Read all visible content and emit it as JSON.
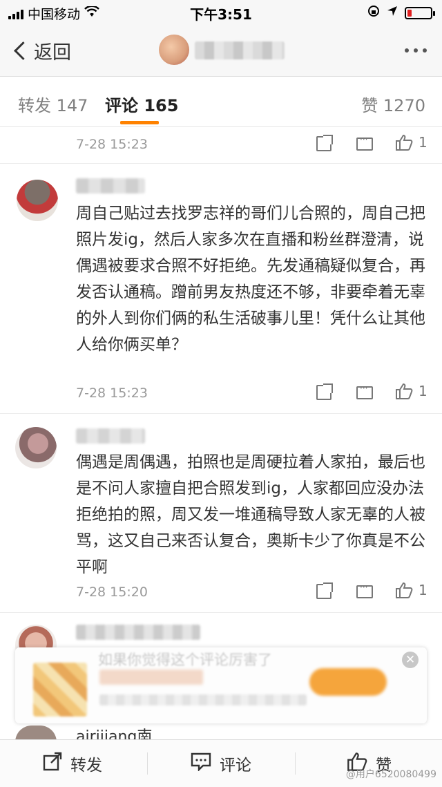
{
  "status_bar": {
    "carrier": "中国移动",
    "time": "下午3:51"
  },
  "nav": {
    "back_label": "返回"
  },
  "tabs": [
    {
      "label": "转发 147"
    },
    {
      "label": "评论 165"
    },
    {
      "label": "赞 1270"
    }
  ],
  "comments": [
    {
      "time": "7-28 15:23",
      "likes": "1"
    },
    {
      "text": "周自己贴过去找罗志祥的哥们儿合照的，周自己把照片发ig，然后人家多次在直播和粉丝群澄清，说偶遇被要求合照不好拒绝。先发通稿疑似复合，再发否认通稿。蹭前男友热度还不够，非要牵着无辜的外人到你们俩的私生活破事儿里！凭什么让其他人给你俩买单？",
      "time": "7-28 15:23",
      "likes": "1"
    },
    {
      "text": "偶遇是周偶遇，拍照也是周硬拉着人家拍，最后也是不问人家擅自把合照发到ig，人家都回应没办法拒绝拍的照，周又发一堆通稿导致人家无辜的人被骂，这又自己来否认复合，奥斯卡少了你真是不公 平啊",
      "time": "7-28 15:20",
      "likes": "1"
    }
  ],
  "popup": {
    "text": "如果你觉得这个评论厉害了"
  },
  "next_username": "airijiang南",
  "toolbar": {
    "forward": "转发",
    "comment": "评论",
    "like": "赞"
  },
  "watermark": "@用户6520080499",
  "colors": {
    "accent": "#ff8200",
    "meta_gray": "#999999",
    "text": "#333333"
  }
}
